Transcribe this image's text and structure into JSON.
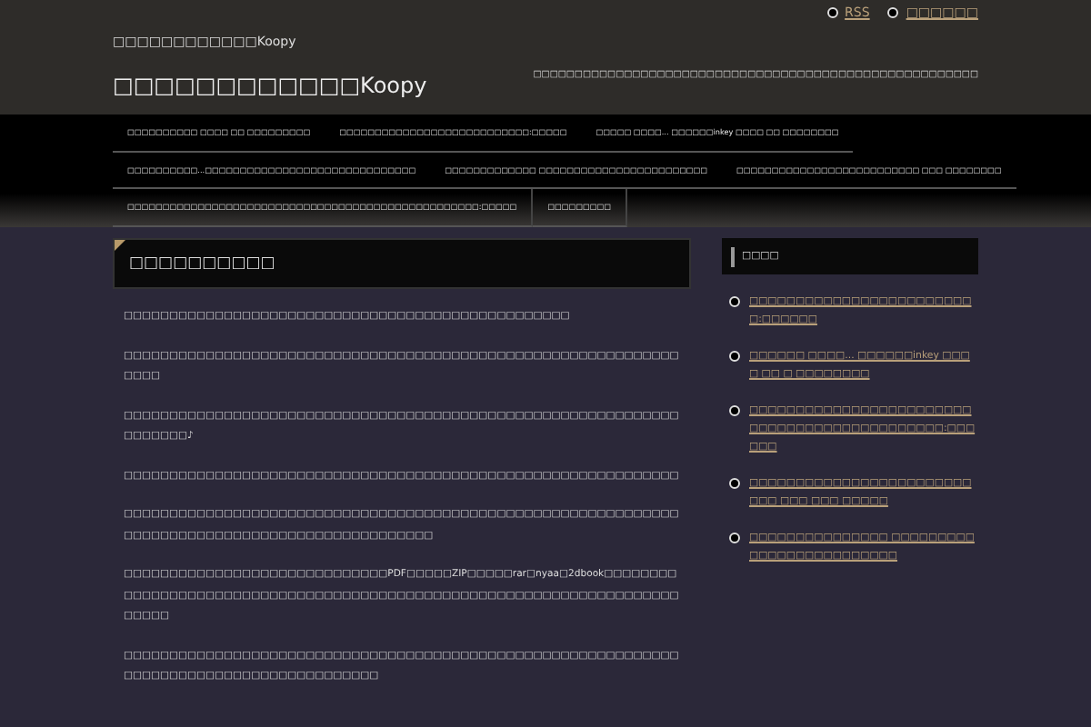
{
  "top_links": [
    "RSS",
    "□□□□□□"
  ],
  "site": {
    "subtitle": "□□□□□□□□□□□□Koopy",
    "title": "□□□□□□□□□□□□Koopy",
    "tagline": "□□□□□□□□□□□□□□□□□□□□□□□□□□□□□□□□□□□□□□□□□□□□□□□□□□□□□□"
  },
  "nav_rows": [
    [
      "□□□□□□□□□□ □□□□ □□ □□□□□□□□□",
      "□□□□□□□□□□□□□□□□□□□□□□□□□□□:□□□□□",
      "□□□□□ □□□□... □□□□□□inkey □□□□ □□ □□□□□□□□"
    ],
    [
      "□□□□□□□□□□...□□□□□□□□□□□□□□□□□□□□□□□□□□□□□□",
      "□□□□□□□□□□□□□ □□□□□□□□□□□□□□□□□□□□□□□□",
      "□□□□□□□□□□□□□□□□□□□□□□□□□□ □□□ □□□□□□□□"
    ],
    [
      "□□□□□□□□□□□□□□□□□□□□□□□□□□□□□□□□□□□□□□□□□□□□□□□□□□:□□□□□",
      "□□□□□□□□□"
    ]
  ],
  "article": {
    "title": "□□□□□□□□□□",
    "paragraphs": [
      "□□□□□□□□□□□□□□□□□□□□□□□□□□□□□□□□□□□□□□□□□□□□□□□□□",
      "□□□□□□□□□□□□□□□□□□□□□□□□□□□□□□□□□□□□□□□□□□□□□□□□□□□□□□□□□□□□□□□□□",
      "□□□□□□□□□□□□□□□□□□□□□□□□□□□□□□□□□□□□□□□□□□□□□□□□□□□□□□□□□□□□□□□□□□□□♪",
      "□□□□□□□□□□□□□□□□□□□□□□□□□□□□□□□□□□□□□□□□□□□□□□□□□□□□□□□□□□□□□",
      "□□□□□□□□□□□□□□□□□□□□□□□□□□□□□□□□□□□□□□□□□□□□□□□□□□□□□□□□□□□□□□□□□□□□□□□□□□□□□□□□□□□□□□□□□□□□□□□",
      "□□□□□□□□□□□□□□□□□□□□□□□□□□□□□PDF□□□□□ZIP□□□□□rar□nyaa□2dbook□□□□□□□□□□□□□□□□□□□□□□□□□□□□□□□□□□□□□□□□□□□□□□□□□□□□□□□□□□□□□□□□□□□□□□□□□□",
      "□□□□□□□□□□□□□□□□□□□□□□□□□□□□□□□□□□□□□□□□□□□□□□□□□□□□□□□□□□□□□□□□□□□□□□□□□□□□□□□□□□□□□□□□□"
    ]
  },
  "sidebar": {
    "title": "□□□□",
    "links": [
      "□□□□□□□□□□□□□□□□□□□□□□□□□:□□□□□□",
      "□□□□□□ □□□□... □□□□□□inkey □□□□ □□ □ □□□□□□□□",
      "□□□□□□□□□□□□□□□□□□□□□□□□□□□□□□□□□□□□□□□□□□□□□:□□□□□□",
      "□□□□□□□□□□□□□□□□□□□□□□□□□□□ □□□ □□□ □□□□□",
      "□□□□□□□□□□□□□□□ □□□□□□□□□□□□□□□□□□□□□□□□□"
    ]
  }
}
